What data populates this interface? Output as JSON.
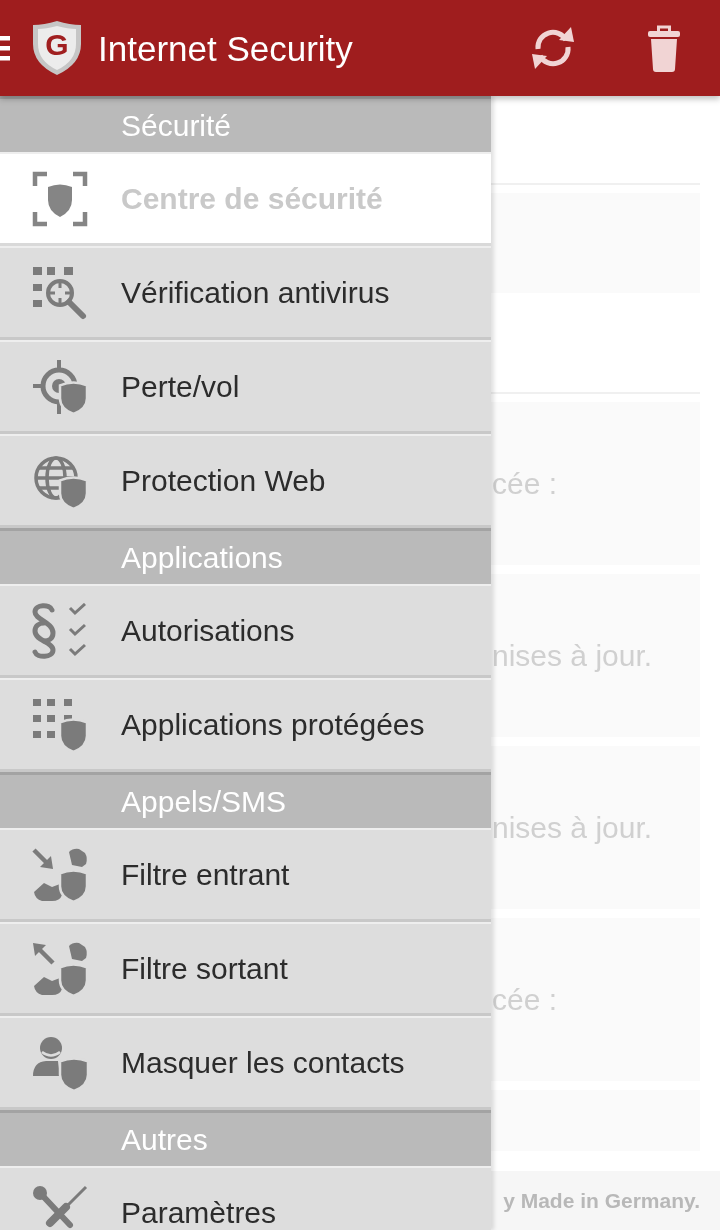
{
  "app_bar": {
    "logo_letter": "G",
    "title": "Internet Security"
  },
  "drawer": {
    "sections": [
      {
        "title": "Sécurité",
        "items": [
          {
            "label": "Centre de sécurité",
            "selected": true
          },
          {
            "label": "Vérification antivirus",
            "selected": false
          },
          {
            "label": "Perte/vol",
            "selected": false
          },
          {
            "label": "Protection Web",
            "selected": false
          }
        ]
      },
      {
        "title": "Applications",
        "items": [
          {
            "label": "Autorisations",
            "selected": false
          },
          {
            "label": "Applications protégées",
            "selected": false
          }
        ]
      },
      {
        "title": "Appels/SMS",
        "items": [
          {
            "label": "Filtre entrant",
            "selected": false
          },
          {
            "label": "Filtre sortant",
            "selected": false
          },
          {
            "label": "Masquer les contacts",
            "selected": false
          }
        ]
      },
      {
        "title": "Autres",
        "items": [
          {
            "label": "Paramètres",
            "selected": false
          }
        ]
      }
    ]
  },
  "content": {
    "cards": [
      {
        "text": "cée :"
      },
      {
        "text": "nises à jour."
      },
      {
        "text": "nises à jour."
      },
      {
        "text": "cée :"
      }
    ]
  },
  "footer": {
    "text": "y Made in Germany."
  }
}
